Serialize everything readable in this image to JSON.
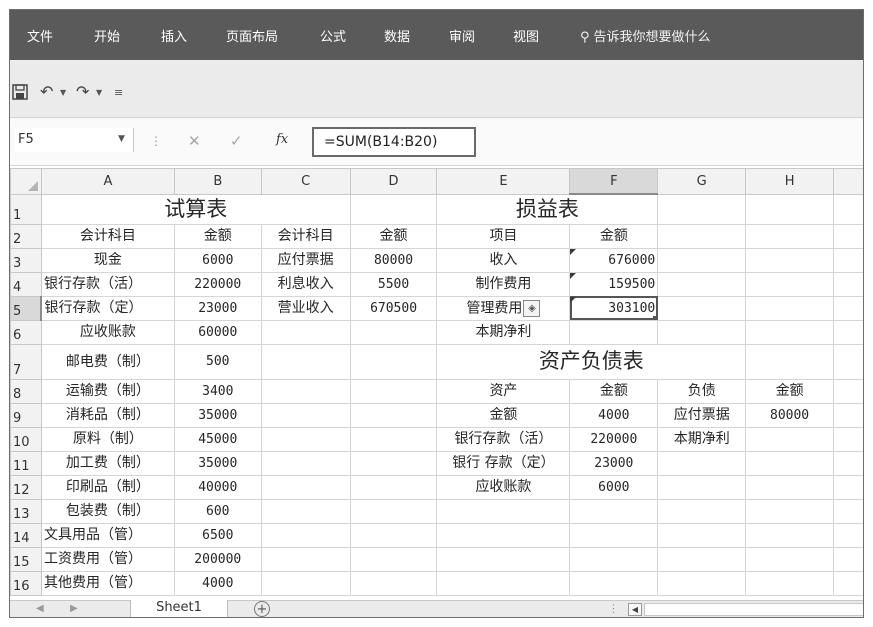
{
  "ribbon": {
    "tabs": [
      "文件",
      "开始",
      "插入",
      "页面布局",
      "公式",
      "数据",
      "审阅",
      "视图"
    ],
    "tell_me": "告诉我你想要做什么"
  },
  "name_box": "F5",
  "formula": "=SUM(B14:B20)",
  "columns": [
    "A",
    "B",
    "C",
    "D",
    "E",
    "F",
    "G",
    "H"
  ],
  "rows": [
    {
      "n": "1",
      "cells": {
        "AB": "试算表",
        "E": "损益表"
      }
    },
    {
      "n": "2",
      "cells": {
        "A": "会计科目",
        "B": "金额",
        "C": "会计科目",
        "D": "金额",
        "E": "项目",
        "F": "金额"
      }
    },
    {
      "n": "3",
      "cells": {
        "A": "现金",
        "B": "6000",
        "C": "应付票据",
        "D": "80000",
        "E": "收入",
        "F": "676000"
      }
    },
    {
      "n": "4",
      "cells": {
        "A": "银行存款（活）",
        "B": "220000",
        "C": "利息收入",
        "D": "5500",
        "E": "制作费用",
        "F": "159500"
      }
    },
    {
      "n": "5",
      "cells": {
        "A": "银行存款（定）",
        "B": "23000",
        "C": "营业收入",
        "D": "670500",
        "E": "管理费用",
        "F": "303100"
      }
    },
    {
      "n": "6",
      "cells": {
        "A": "应收账款",
        "B": "60000",
        "E": "本期净利"
      }
    },
    {
      "n": "7",
      "cells": {
        "A": "邮电费（制）",
        "B": "500",
        "E": "资产负债表"
      }
    },
    {
      "n": "8",
      "cells": {
        "A": "运输费（制）",
        "B": "3400",
        "E": "资产",
        "F": "金额",
        "G": "负债",
        "H": "金额"
      }
    },
    {
      "n": "9",
      "cells": {
        "A": "消耗品（制）",
        "B": "35000",
        "E": "金额",
        "F": "4000",
        "G": "应付票据",
        "H": "80000"
      }
    },
    {
      "n": "10",
      "cells": {
        "A": "原料（制）",
        "B": "45000",
        "E": "银行存款（活）",
        "F": "220000",
        "G": "本期净利"
      }
    },
    {
      "n": "11",
      "cells": {
        "A": "加工费（制）",
        "B": "35000",
        "E": "银行 存款（定）",
        "F": "23000"
      }
    },
    {
      "n": "12",
      "cells": {
        "A": "印刷品（制）",
        "B": "40000",
        "E": "应收账款",
        "F": "6000"
      }
    },
    {
      "n": "13",
      "cells": {
        "A": "包装费（制）",
        "B": "600"
      }
    },
    {
      "n": "14",
      "cells": {
        "A": "文具用品（管）",
        "B": "6500"
      }
    },
    {
      "n": "15",
      "cells": {
        "A": "工资费用（管）",
        "B": "200000"
      }
    },
    {
      "n": "16",
      "cells": {
        "A": "其他费用（管）",
        "B": "4000"
      }
    }
  ],
  "sheet_tab": "Sheet1",
  "add_sheet": "+"
}
